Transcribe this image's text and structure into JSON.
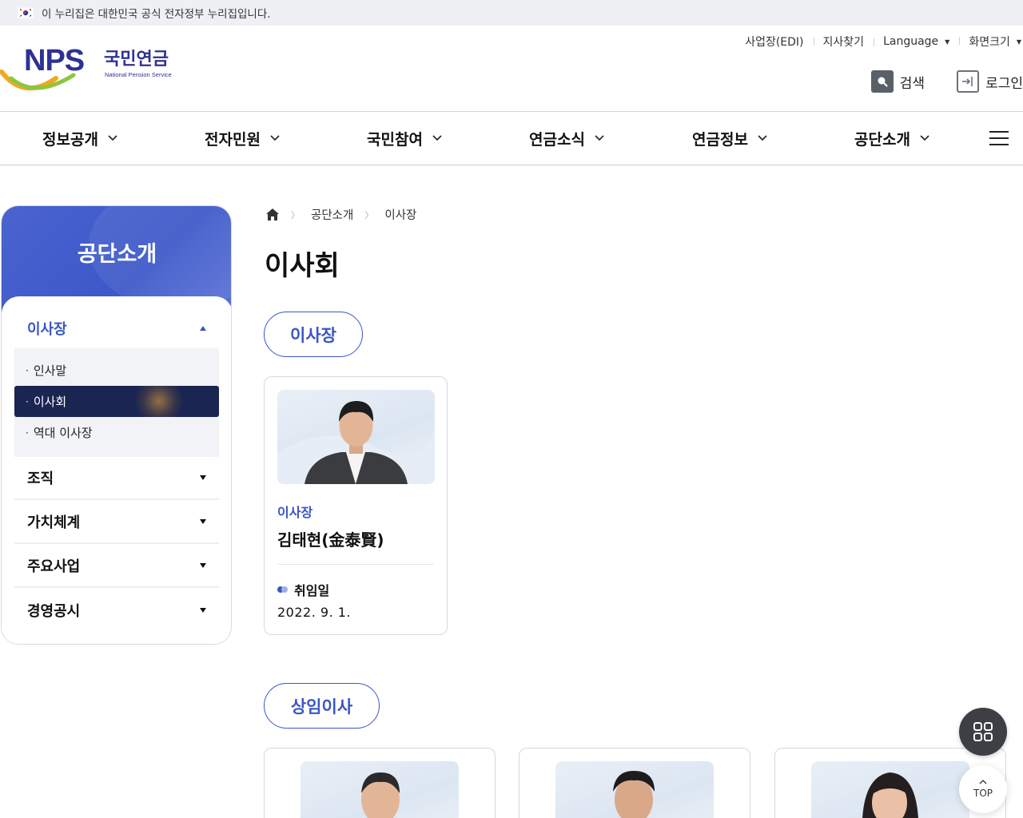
{
  "gov_banner": {
    "text": "이 누리집은 대한민국 공식 전자정부 누리집입니다."
  },
  "header": {
    "logo": {
      "wordmark": "NPS",
      "korean_name": "국민연금",
      "english_name": "National Pension Service"
    },
    "utility_links": [
      {
        "label": "사업장(EDI)",
        "dropdown": false
      },
      {
        "label": "지사찾기",
        "dropdown": false
      },
      {
        "label": "Language",
        "dropdown": true
      },
      {
        "label": "화면크기",
        "dropdown": true
      }
    ],
    "actions": {
      "search_label": "검색",
      "login_label": "로그인"
    }
  },
  "gnb": {
    "items": [
      "정보공개",
      "전자민원",
      "국민참여",
      "연금소식",
      "연금정보",
      "공단소개"
    ]
  },
  "lnb": {
    "title": "공단소개",
    "open_section": "이사장",
    "sub_items": [
      {
        "label": "인사말",
        "active": false
      },
      {
        "label": "이사회",
        "active": true
      },
      {
        "label": "역대 이사장",
        "active": false
      }
    ],
    "sections": [
      "조직",
      "가치체계",
      "주요사업",
      "경영공시"
    ]
  },
  "breadcrumb": {
    "items": [
      "공단소개",
      "이사장"
    ]
  },
  "page_title": "이사회",
  "groups": [
    {
      "heading": "이사장",
      "members": [
        {
          "role": "이사장",
          "name": "김태현(金泰賢)",
          "field_label": "취임일",
          "field_value": "2022. 9. 1."
        }
      ]
    },
    {
      "heading": "상임이사"
    }
  ],
  "floating": {
    "top_label": "TOP"
  },
  "colors": {
    "accent": "#3a55c7",
    "lnb_active": "#1b2552",
    "float_dark": "#3d3f45"
  }
}
